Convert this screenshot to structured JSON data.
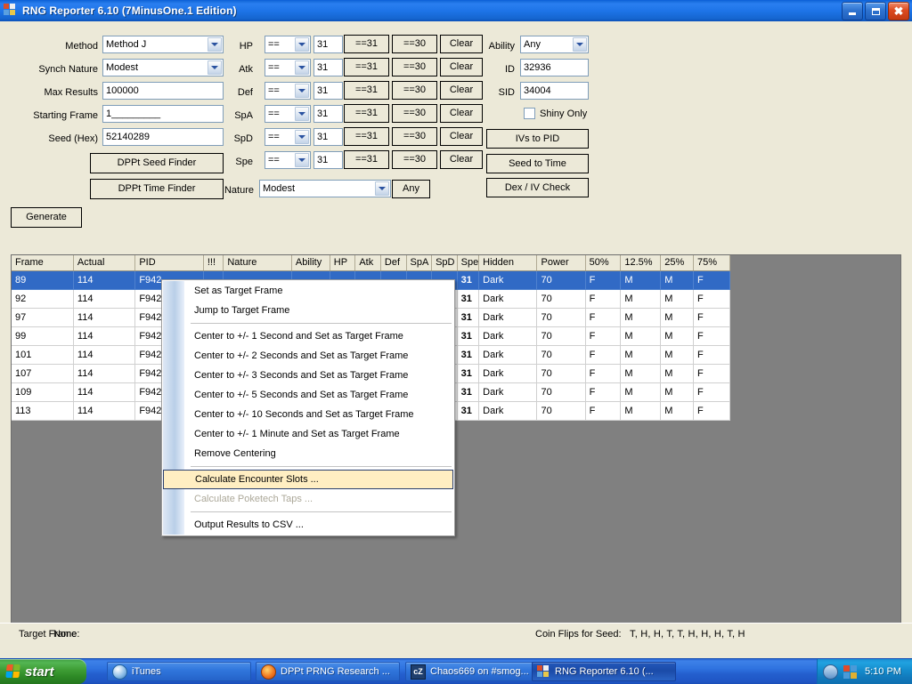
{
  "window": {
    "title": "RNG Reporter 6.10 (7MinusOne.1 Edition)",
    "icon": "app-window-icon",
    "minimize_label": "Minimize",
    "maximize_label": "Restore",
    "close_label": "Close",
    "accent_title_color": "#1e74e8"
  },
  "form": {
    "method": {
      "label": "Method",
      "value": "Method J"
    },
    "synch_nature": {
      "label": "Synch Nature",
      "value": "Modest"
    },
    "max_results": {
      "label": "Max Results",
      "value": "100000"
    },
    "starting_frame": {
      "label": "Starting Frame",
      "value": "1_________"
    },
    "seed_hex": {
      "label": "Seed (Hex)",
      "value": "52140289"
    },
    "dppt_seed_finder": "DPPt Seed Finder",
    "dppt_time_finder": "DPPt Time Finder",
    "generate": "Generate"
  },
  "ivs": {
    "rows": [
      {
        "label": "HP",
        "op": "==",
        "value": "31",
        "b31": "==31",
        "b30": "==30",
        "clear": "Clear"
      },
      {
        "label": "Atk",
        "op": "==",
        "value": "31",
        "b31": "==31",
        "b30": "==30",
        "clear": "Clear"
      },
      {
        "label": "Def",
        "op": "==",
        "value": "31",
        "b31": "==31",
        "b30": "==30",
        "clear": "Clear"
      },
      {
        "label": "SpA",
        "op": "==",
        "value": "31",
        "b31": "==31",
        "b30": "==30",
        "clear": "Clear"
      },
      {
        "label": "SpD",
        "op": "==",
        "value": "31",
        "b31": "==31",
        "b30": "==30",
        "clear": "Clear"
      },
      {
        "label": "Spe",
        "op": "==",
        "value": "31",
        "b31": "==31",
        "b30": "==30",
        "clear": "Clear"
      }
    ],
    "nature": {
      "label": "Nature",
      "value": "Modest",
      "any_button": "Any"
    }
  },
  "trainer": {
    "ability": {
      "label": "Ability",
      "value": "Any"
    },
    "id": {
      "label": "ID",
      "value": "32936"
    },
    "sid": {
      "label": "SID",
      "value": "34004"
    },
    "shiny_only": {
      "label": "Shiny Only",
      "checked": false
    },
    "ivs_to_pid": "IVs to PID",
    "seed_to_time": "Seed to Time",
    "dex_iv_check": "Dex / IV Check"
  },
  "grid": {
    "columns": [
      "Frame",
      "Actual",
      "PID",
      "!!!",
      "Nature",
      "Ability",
      "HP",
      "Atk",
      "Def",
      "SpA",
      "SpD",
      "Spe",
      "Hidden",
      "Power",
      "50%",
      "12.5%",
      "25%",
      "75%"
    ],
    "rows": [
      {
        "selected": true,
        "cells": [
          "89",
          "114",
          "F942",
          "",
          "",
          "",
          "",
          "",
          "",
          "",
          "",
          "31",
          "Dark",
          "70",
          "F",
          "M",
          "M",
          "F"
        ]
      },
      {
        "selected": false,
        "cells": [
          "92",
          "114",
          "F942",
          "",
          "",
          "",
          "",
          "",
          "",
          "",
          "",
          "31",
          "Dark",
          "70",
          "F",
          "M",
          "M",
          "F"
        ]
      },
      {
        "selected": false,
        "cells": [
          "97",
          "114",
          "F942",
          "",
          "",
          "",
          "",
          "",
          "",
          "",
          "",
          "31",
          "Dark",
          "70",
          "F",
          "M",
          "M",
          "F"
        ]
      },
      {
        "selected": false,
        "cells": [
          "99",
          "114",
          "F942",
          "",
          "",
          "",
          "",
          "",
          "",
          "",
          "",
          "31",
          "Dark",
          "70",
          "F",
          "M",
          "M",
          "F"
        ]
      },
      {
        "selected": false,
        "cells": [
          "101",
          "114",
          "F942",
          "",
          "",
          "",
          "",
          "",
          "",
          "",
          "",
          "31",
          "Dark",
          "70",
          "F",
          "M",
          "M",
          "F"
        ]
      },
      {
        "selected": false,
        "cells": [
          "107",
          "114",
          "F942",
          "",
          "",
          "",
          "",
          "",
          "",
          "",
          "",
          "31",
          "Dark",
          "70",
          "F",
          "M",
          "M",
          "F"
        ]
      },
      {
        "selected": false,
        "cells": [
          "109",
          "114",
          "F942",
          "",
          "",
          "",
          "",
          "",
          "",
          "",
          "",
          "31",
          "Dark",
          "70",
          "F",
          "M",
          "M",
          "F"
        ]
      },
      {
        "selected": false,
        "cells": [
          "113",
          "114",
          "F942",
          "",
          "",
          "",
          "",
          "",
          "",
          "",
          "",
          "31",
          "Dark",
          "70",
          "F",
          "M",
          "M",
          "F"
        ]
      }
    ]
  },
  "context_menu": {
    "items": [
      {
        "label": "Set as Target Frame",
        "state": "normal"
      },
      {
        "label": "Jump to Target Frame",
        "state": "normal"
      },
      {
        "separator": true
      },
      {
        "label": "Center to +/- 1 Second and Set as Target Frame",
        "state": "normal"
      },
      {
        "label": "Center to +/- 2 Seconds and Set as Target Frame",
        "state": "normal"
      },
      {
        "label": "Center to +/- 3 Seconds and Set as Target Frame",
        "state": "normal"
      },
      {
        "label": "Center to +/- 5 Seconds and Set as Target Frame",
        "state": "normal"
      },
      {
        "label": "Center to +/- 10 Seconds and Set as Target Frame",
        "state": "normal"
      },
      {
        "label": "Center to +/- 1 Minute and Set as Target Frame",
        "state": "normal"
      },
      {
        "label": "Remove Centering",
        "state": "normal"
      },
      {
        "separator": true
      },
      {
        "label": "Calculate Encounter Slots ...",
        "state": "highlighted"
      },
      {
        "label": "Calculate Poketech Taps ...",
        "state": "disabled"
      },
      {
        "separator": true
      },
      {
        "label": "Output Results to CSV ...",
        "state": "normal"
      }
    ],
    "highlight_color": "#ffeec2"
  },
  "statusbar": {
    "target_frame_label": "Target Frame:",
    "target_frame_value": "None",
    "coin_flips_label": "Coin Flips for Seed:",
    "coin_flips_value": "T, H, H, T, T, H, H, H, T, H"
  },
  "taskbar": {
    "start_label": "start",
    "items": [
      {
        "label": "iTunes",
        "icon": "itunes-icon",
        "active": false
      },
      {
        "label": "DPPt PRNG Research ...",
        "icon": "firefox-icon",
        "active": false
      },
      {
        "label": "Chaos669 on #smog...",
        "icon": "chatzilla-icon",
        "active": false
      },
      {
        "label": "RNG Reporter 6.10 (...",
        "icon": "app-window-icon",
        "active": true
      }
    ],
    "clock": "5:10 PM",
    "tray_icons": [
      "volume-icon",
      "network-icon"
    ]
  }
}
